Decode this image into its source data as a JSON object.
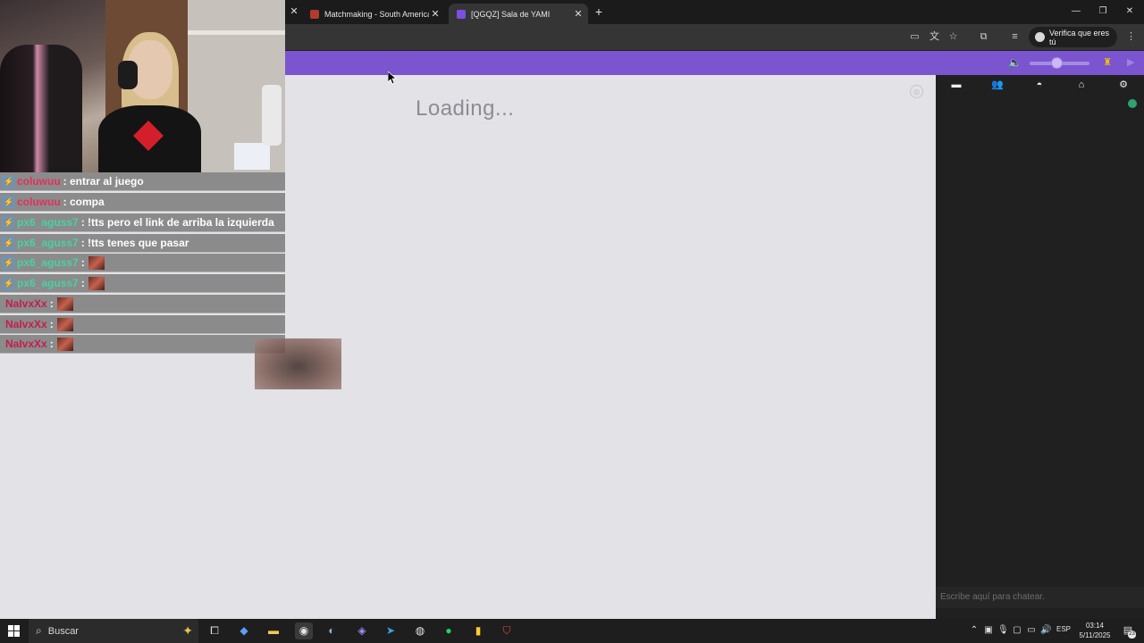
{
  "browser": {
    "tabs": [
      {
        "title": "Matchmaking - South America"
      },
      {
        "title": "[QGQZ] Sala de YAMI"
      }
    ],
    "new_tab_icon": "+",
    "toolbar": {
      "verify_label": "Verifica que eres tú"
    }
  },
  "game": {
    "loading_text": "Loading...",
    "volume_level_percent": 45,
    "side_tabs": [
      "chat-icon",
      "players-icon",
      "game-icon",
      "home-icon",
      "settings-icon"
    ],
    "chat_placeholder": "Escribe aquí para chatear."
  },
  "stream_chat": {
    "messages": [
      {
        "user": "coluwuu",
        "color": "#e2305a",
        "text": ": entrar al juego",
        "badge": true,
        "emote": false
      },
      {
        "user": "coluwuu",
        "color": "#e2305a",
        "text": ": compa",
        "badge": true,
        "emote": false
      },
      {
        "user": "px6_aguss7",
        "color": "#46d2a4",
        "text": ": !tts pero el link de arriba la izquierda",
        "badge": true,
        "emote": false
      },
      {
        "user": "px6_aguss7",
        "color": "#46d2a4",
        "text": ": !tts tenes que pasar",
        "badge": true,
        "emote": false
      },
      {
        "user": "px6_aguss7",
        "color": "#46d2a4",
        "text": ":",
        "badge": true,
        "emote": true
      },
      {
        "user": "px6_aguss7",
        "color": "#46d2a4",
        "text": ":",
        "badge": true,
        "emote": true
      },
      {
        "user": "NaIvxXx",
        "color": "#c41e4d",
        "text": ":",
        "badge": false,
        "emote": true
      },
      {
        "user": "NaIvxXx",
        "color": "#c41e4d",
        "text": ":",
        "badge": false,
        "emote": true
      },
      {
        "user": "NaIvxXx",
        "color": "#c41e4d",
        "text": ":",
        "badge": false,
        "emote": true
      }
    ]
  },
  "taskbar": {
    "search_label": "Buscar",
    "language": "ESP",
    "time": "03:14",
    "date": "5/11/2025",
    "notifications": "23"
  },
  "colors": {
    "accent_purple": "#7b55cf",
    "canvas_bg": "#e2e2e7",
    "panel_bg": "#202020"
  }
}
